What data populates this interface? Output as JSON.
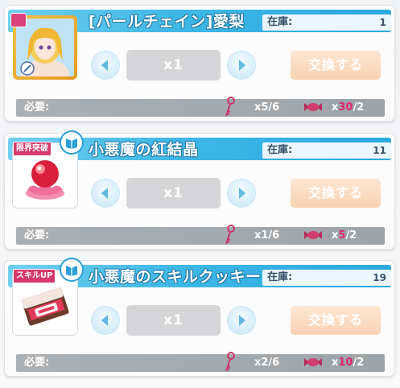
{
  "labels": {
    "stock": "在庫:",
    "required": "必要:",
    "exchange": "交換する"
  },
  "colors": {
    "header_blue": "#2aa9df",
    "insufficient_red": "#e0256b",
    "exchange_disabled": "#f9d2b3"
  },
  "items": [
    {
      "title": "[パールチェイン]愛梨",
      "stock": "1",
      "quantity": "x1",
      "req_key": "x5/6",
      "req_candy_prefix": "x",
      "req_candy_have": "30",
      "req_candy_need": "/2",
      "thumbnail": "character-card-portrait",
      "badge": ""
    },
    {
      "title": "小悪魔の紅結晶",
      "stock": "11",
      "quantity": "x1",
      "req_key": "x1/6",
      "req_candy_prefix": "x",
      "req_candy_have": "5",
      "req_candy_need": "/2",
      "thumbnail": "red-crystal-icon",
      "badge": "限界突破"
    },
    {
      "title": "小悪魔のスキルクッキー",
      "stock": "19",
      "quantity": "x1",
      "req_key": "x2/6",
      "req_candy_prefix": "x",
      "req_candy_have": "10",
      "req_candy_need": "/2",
      "thumbnail": "skill-cookie-icon",
      "badge": "スキルUP"
    }
  ]
}
